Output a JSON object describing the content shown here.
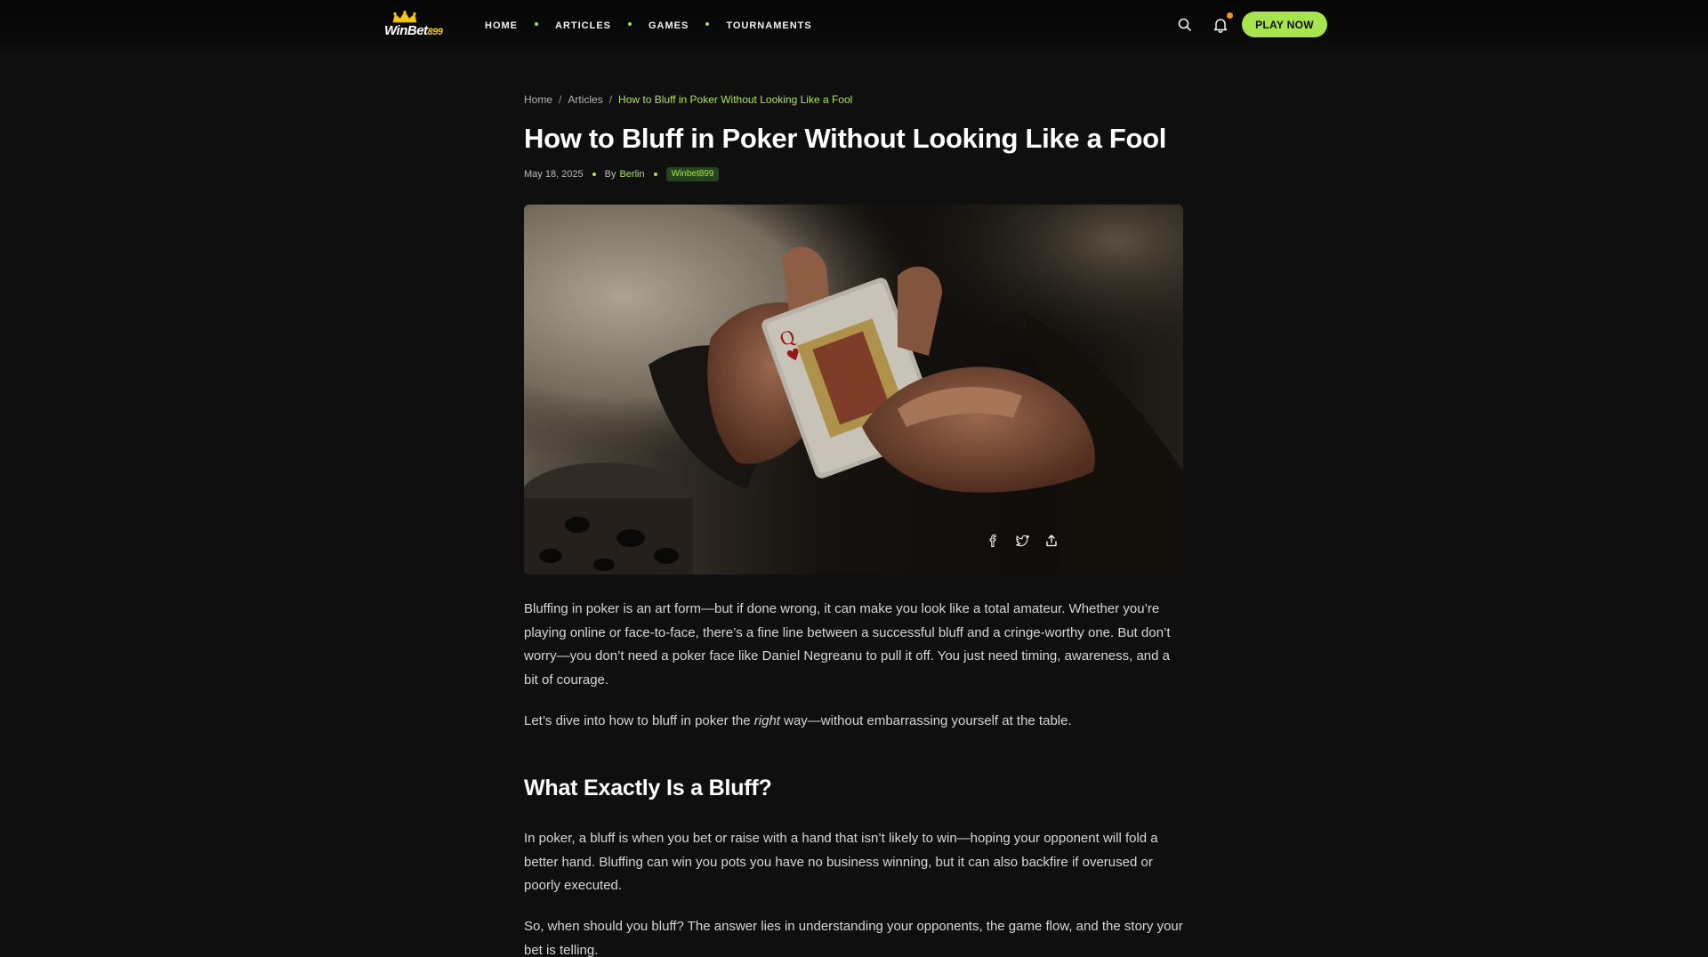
{
  "brand": {
    "name": "WinBet",
    "number": "899",
    "accent": "#a8e44e"
  },
  "nav": {
    "items": [
      {
        "label": "HOME"
      },
      {
        "label": "ARTICLES"
      },
      {
        "label": "GAMES"
      },
      {
        "label": "TOURNAMENTS"
      }
    ]
  },
  "header": {
    "search_icon": "search-icon",
    "bell_icon": "bell-icon",
    "play_label": "PLAY NOW"
  },
  "breadcrumb": {
    "home": "Home",
    "articles": "Articles",
    "separator": "/",
    "current": "How to Bluff in Poker Without Looking Like a Fool"
  },
  "article": {
    "title": "How to Bluff in Poker Without Looking Like a Fool",
    "date": "May 18, 2025",
    "by": "By",
    "author": "Berlin",
    "tag": "Winbet899",
    "share_icons": [
      "facebook-icon",
      "twitter-icon",
      "share-icon"
    ],
    "intro_p1": "Bluffing in poker is an art form—but if done wrong, it can make you look like a total amateur. Whether you’re playing online or face-to-face, there’s a fine line between a successful bluff and a cringe-worthy one. But don’t worry—you don’t need a poker face like Daniel Negreanu to pull it off. You just need timing, awareness, and a bit of courage.",
    "intro_p2_before": "Let’s dive into how to bluff in poker the ",
    "intro_p2_em": "right",
    "intro_p2_after": " way—without embarrassing yourself at the table.",
    "section1_heading": "What Exactly Is a Bluff?",
    "section1_p1": "In poker, a bluff is when you bet or raise with a hand that isn’t likely to win—hoping your opponent will fold a better hand. Bluffing can win you pots you have no business winning, but it can also backfire if overused or poorly executed.",
    "section1_p2": "So, when should you bluff? The answer lies in understanding your opponents, the game flow, and the story your bet is telling."
  }
}
